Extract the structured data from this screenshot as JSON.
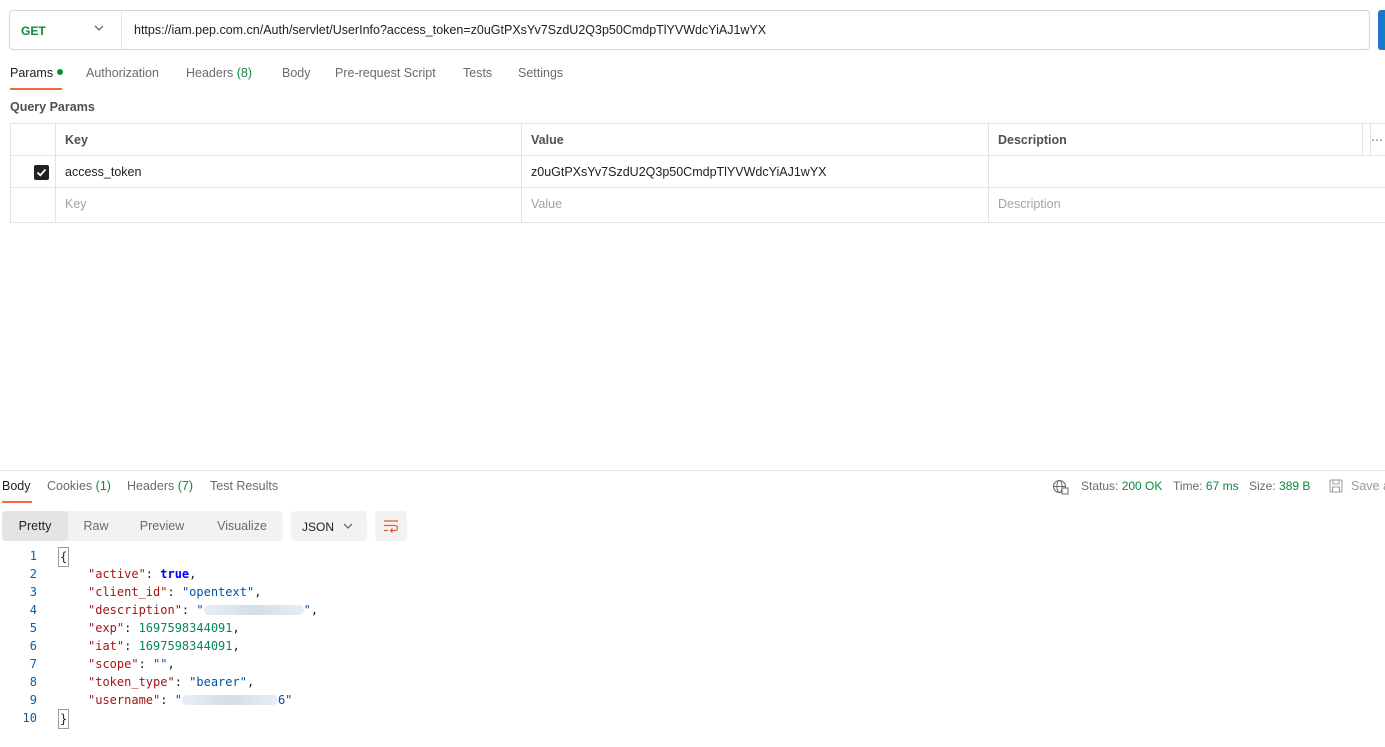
{
  "request": {
    "method": "GET",
    "url": "https://iam.pep.com.cn/Auth/servlet/UserInfo?access_token=z0uGtPXsYv7SzdU2Q3p50CmdpTlYVWdcYiAJ1wYX"
  },
  "request_tabs": [
    {
      "label": "Params",
      "count": "",
      "active": true,
      "dot": true
    },
    {
      "label": "Authorization",
      "count": ""
    },
    {
      "label": "Headers",
      "count": "(8)"
    },
    {
      "label": "Body",
      "count": ""
    },
    {
      "label": "Pre-request Script",
      "count": ""
    },
    {
      "label": "Tests",
      "count": ""
    },
    {
      "label": "Settings",
      "count": ""
    }
  ],
  "query_params": {
    "title": "Query Params",
    "headers": {
      "key": "Key",
      "value": "Value",
      "description": "Description"
    },
    "rows": [
      {
        "checked": true,
        "key": "access_token",
        "value": "z0uGtPXsYv7SzdU2Q3p50CmdpTlYVWdcYiAJ1wYX",
        "description": ""
      }
    ],
    "placeholder": {
      "key": "Key",
      "value": "Value",
      "description": "Description"
    }
  },
  "response_tabs": [
    {
      "label": "Body",
      "count": "",
      "active": true
    },
    {
      "label": "Cookies",
      "count": "(1)"
    },
    {
      "label": "Headers",
      "count": "(7)"
    },
    {
      "label": "Test Results",
      "count": ""
    }
  ],
  "status": {
    "status_label": "Status:",
    "status_value": "200 OK",
    "time_label": "Time:",
    "time_value": "67 ms",
    "size_label": "Size:",
    "size_value": "389 B",
    "save_label": "Save a"
  },
  "view_modes": [
    "Pretty",
    "Raw",
    "Preview",
    "Visualize"
  ],
  "format": "JSON",
  "code_lines": [
    {
      "n": "1",
      "text": "{"
    },
    {
      "n": "2",
      "key": "\"active\"",
      "value": "true",
      "type": "bool",
      "comma": ","
    },
    {
      "n": "3",
      "key": "\"client_id\"",
      "value": "\"opentext\"",
      "type": "string",
      "comma": ","
    },
    {
      "n": "4",
      "key": "\"description\"",
      "value": "\"",
      "value_end": "\"",
      "type": "redacted",
      "comma": ","
    },
    {
      "n": "5",
      "key": "\"exp\"",
      "value": "1697598344091",
      "type": "number",
      "comma": ","
    },
    {
      "n": "6",
      "key": "\"iat\"",
      "value": "1697598344091",
      "type": "number",
      "comma": ","
    },
    {
      "n": "7",
      "key": "\"scope\"",
      "value": "\"\"",
      "type": "string",
      "comma": ","
    },
    {
      "n": "8",
      "key": "\"token_type\"",
      "value": "\"bearer\"",
      "type": "string",
      "comma": ","
    },
    {
      "n": "9",
      "key": "\"username\"",
      "value": "\"",
      "value_end": "6\"",
      "type": "redacted",
      "comma": ""
    },
    {
      "n": "10",
      "text": "}"
    }
  ],
  "colors": {
    "accent": "#f26b3a",
    "success": "#0a8a3c",
    "send": "#1b78d0"
  }
}
